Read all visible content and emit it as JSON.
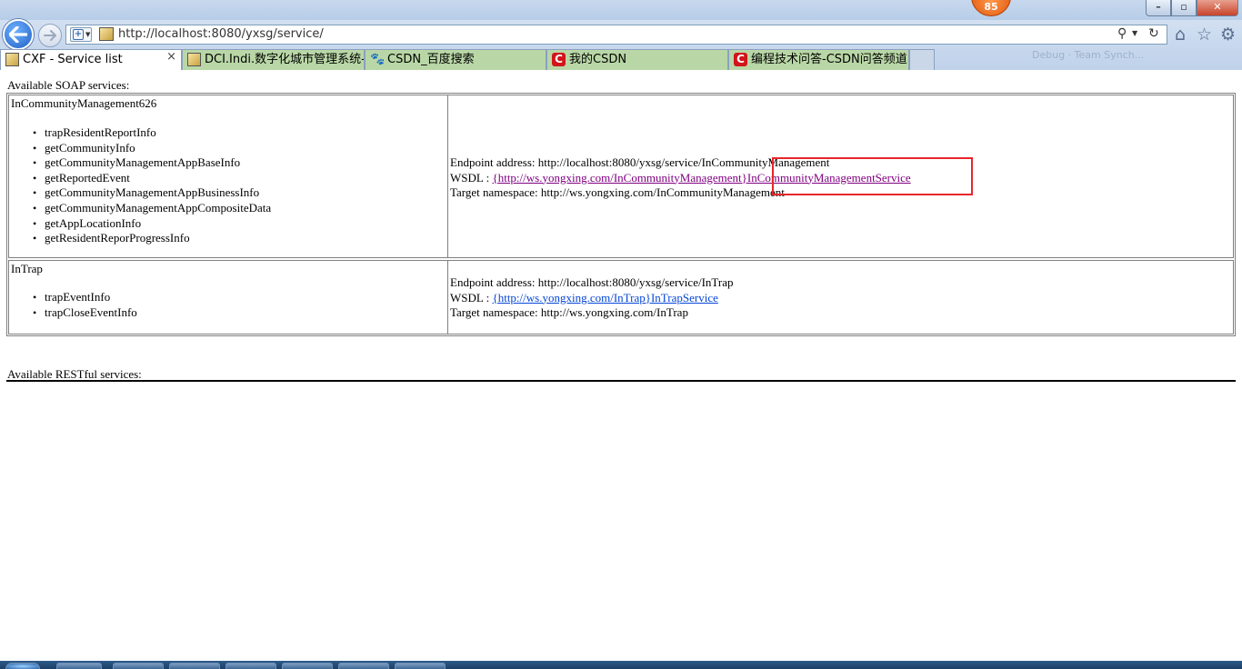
{
  "browser": {
    "notification_count": "85",
    "address": "http://localhost:8080/yxsg/service/",
    "tabs": [
      {
        "label": "CXF - Service list",
        "icon": "page-icon",
        "active": true,
        "close": "×"
      },
      {
        "label": "DCI.Indi.数字化城市管理系统-...",
        "icon": "page-icon"
      },
      {
        "label": "CSDN_百度搜索",
        "icon": "baidu-paw-icon"
      },
      {
        "label": "我的CSDN",
        "icon": "csdn-icon"
      },
      {
        "label": "编程技术问答-CSDN问答频道",
        "icon": "csdn-icon"
      }
    ],
    "ghost_toolbar": "Debug  ·  Team Synch..."
  },
  "page": {
    "soap_heading": "Available SOAP services:",
    "services": [
      {
        "name": "InCommunityManagement626",
        "operations": [
          "trapResidentReportInfo",
          "getCommunityInfo",
          "getCommunityManagementAppBaseInfo",
          "getReportedEvent",
          "getCommunityManagementAppBusinessInfo",
          "getCommunityManagementAppCompositeData",
          "getAppLocationInfo",
          "getResidentReporProgressInfo"
        ],
        "endpoint_label": "Endpoint address: ",
        "endpoint": "http://localhost:8080/yxsg/service/InCommunityManagement",
        "wsdl_label": "WSDL : ",
        "wsdl": "{http://ws.yongxing.com/InCommunityManagement}InCommunityManagementService",
        "namespace_label": "Target namespace: ",
        "namespace": "http://ws.yongxing.com/InCommunityManagement"
      },
      {
        "name": "InTrap",
        "operations": [
          "trapEventInfo",
          "trapCloseEventInfo"
        ],
        "endpoint_label": "Endpoint address: ",
        "endpoint": "http://localhost:8080/yxsg/service/InTrap",
        "wsdl_label": "WSDL : ",
        "wsdl": "{http://ws.yongxing.com/InTrap}InTrapService",
        "namespace_label": "Target namespace: ",
        "namespace": "http://ws.yongxing.com/InTrap"
      }
    ],
    "rest_heading": "Available RESTful services:"
  },
  "colors": {
    "visited_link": "#800080",
    "link": "#0645d8",
    "highlight_box": "#e8262c",
    "inactive_tab": "#b9d7a6"
  }
}
